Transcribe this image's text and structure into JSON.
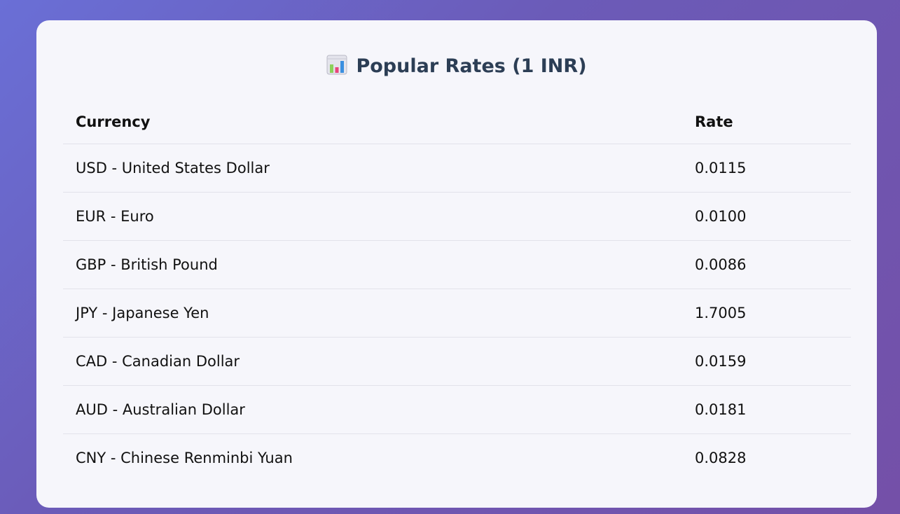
{
  "card": {
    "icon": "bar-chart-icon",
    "title": "Popular Rates (1 INR)"
  },
  "table": {
    "headers": [
      "Currency",
      "Rate"
    ],
    "rows": [
      {
        "currency": "USD - United States Dollar",
        "rate": "0.0115"
      },
      {
        "currency": "EUR - Euro",
        "rate": "0.0100"
      },
      {
        "currency": "GBP - British Pound",
        "rate": "0.0086"
      },
      {
        "currency": "JPY - Japanese Yen",
        "rate": "1.7005"
      },
      {
        "currency": "CAD - Canadian Dollar",
        "rate": "0.0159"
      },
      {
        "currency": "AUD - Australian Dollar",
        "rate": "0.0181"
      },
      {
        "currency": "CNY - Chinese Renminbi Yuan",
        "rate": "0.0828"
      }
    ]
  },
  "colors": {
    "title": "#2c3e55",
    "card_background": "#f6f6fb",
    "background_start": "#6a6fd6",
    "background_end": "#7450a8"
  }
}
